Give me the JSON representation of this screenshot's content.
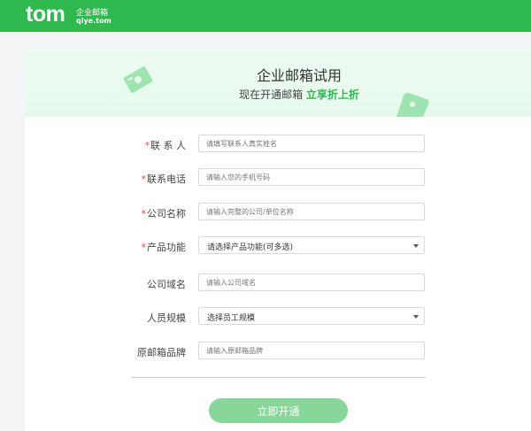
{
  "header": {
    "logo_main": "tom",
    "logo_cn": "企业邮箱",
    "logo_en": "qiye.tom"
  },
  "banner": {
    "title": "企业邮箱试用",
    "subtitle_prefix": "现在开通邮箱 ",
    "subtitle_highlight": "立享折上折"
  },
  "form": {
    "fields": [
      {
        "label": "联 系 人",
        "required": "*",
        "placeholder": "请填写联系人真实姓名",
        "type": "input"
      },
      {
        "label": "联系电话",
        "required": "*",
        "placeholder": "请输入您的手机号码",
        "type": "input"
      },
      {
        "label": "公司名称",
        "required": "*",
        "placeholder": "请输入完整的公司/单位名称",
        "type": "input"
      },
      {
        "label": "产品功能",
        "required": "*",
        "value": "请选择产品功能(可多选)",
        "type": "select"
      },
      {
        "label": "公司域名",
        "required": "",
        "placeholder": "请输入公司域名",
        "type": "input"
      },
      {
        "label": "人员规模",
        "required": "",
        "value": "选择员工规模",
        "type": "select"
      },
      {
        "label": "原邮箱品牌",
        "required": "",
        "placeholder": "请输入原邮箱品牌",
        "type": "input"
      }
    ],
    "submit_label": "立即开通"
  },
  "colors": {
    "brand_green": "#2fb94f",
    "button_green": "#88d699",
    "required_red": "#e74c3c"
  }
}
